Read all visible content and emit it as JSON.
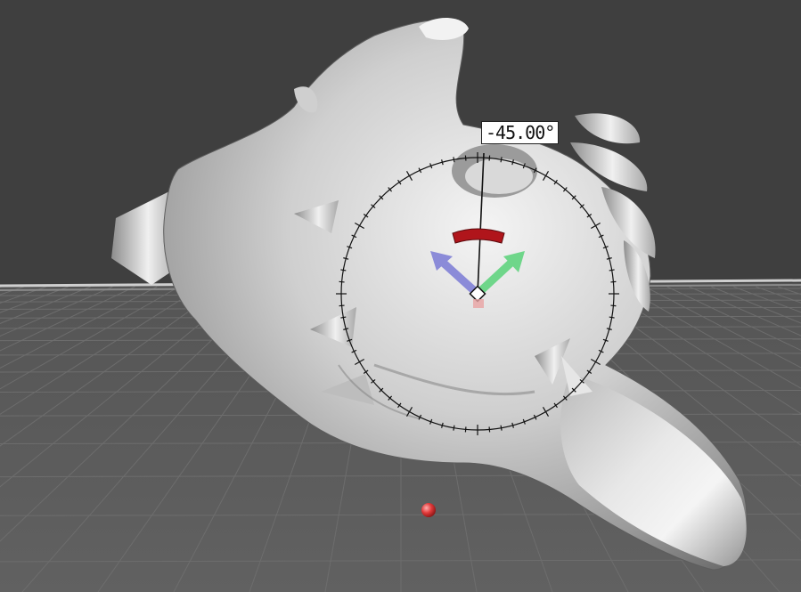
{
  "viewport": {
    "background_color": "#3f3f3f",
    "floor_color": "#5a5a5a",
    "grid_color": "#6d6d6d",
    "horizon_color": "#c8c8c8"
  },
  "model": {
    "name": "sculpted-creature-head",
    "material_color": "#d6d6d6"
  },
  "rotate_gizmo": {
    "angle_readout": "-45.00°",
    "arc_color": "#b0151b",
    "axis_colors": {
      "blue": "#8b8bd8",
      "green": "#6fd68a",
      "red": "#b0151b"
    },
    "icons": [
      "rotate-ring-icon",
      "arrow-blue-icon",
      "arrow-green-icon",
      "red-arc-handle-icon",
      "pivot-icon"
    ]
  },
  "scene_marker": {
    "color": "#e23b3b",
    "icon": "red-sphere-icon"
  }
}
